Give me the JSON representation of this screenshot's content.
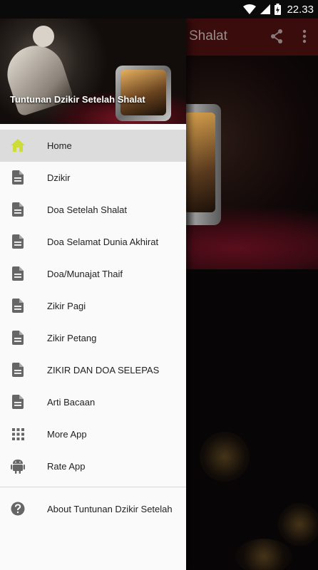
{
  "status_bar": {
    "time": "22.33",
    "icons": [
      "wifi-icon",
      "signal-icon",
      "battery-charging-icon"
    ]
  },
  "background_app": {
    "toolbar_title_fragment": "Shalat",
    "actions": [
      "share-icon",
      "more-vert-icon"
    ]
  },
  "drawer": {
    "header_title": "Tuntunan Dzikir Setelah Shalat",
    "items": [
      {
        "label": "Home",
        "icon": "home-icon",
        "active": true
      },
      {
        "label": "Dzikir",
        "icon": "document-icon"
      },
      {
        "label": "Doa Setelah Shalat",
        "icon": "document-icon"
      },
      {
        "label": "Doa Selamat Dunia Akhirat",
        "icon": "document-icon"
      },
      {
        "label": "Doa/Munajat Thaif",
        "icon": "document-icon"
      },
      {
        "label": "Zikir Pagi",
        "icon": "document-icon"
      },
      {
        "label": "Zikir Petang",
        "icon": "document-icon"
      },
      {
        "label": "ZIKIR DAN DOA SELEPAS",
        "icon": "document-icon"
      },
      {
        "label": "Arti Bacaan",
        "icon": "document-icon"
      },
      {
        "label": "More App",
        "icon": "apps-grid-icon"
      },
      {
        "label": "Rate App",
        "icon": "android-icon"
      }
    ],
    "footer_item": {
      "label": "About Tuntunan Dzikir Setelah",
      "icon": "help-circle-icon"
    }
  },
  "colors": {
    "active_icon": "#cddc39",
    "inactive_icon": "#666666",
    "toolbar": "#3a0c0c",
    "drawer_bg": "#fafafa",
    "active_row": "#dcdcdc"
  }
}
